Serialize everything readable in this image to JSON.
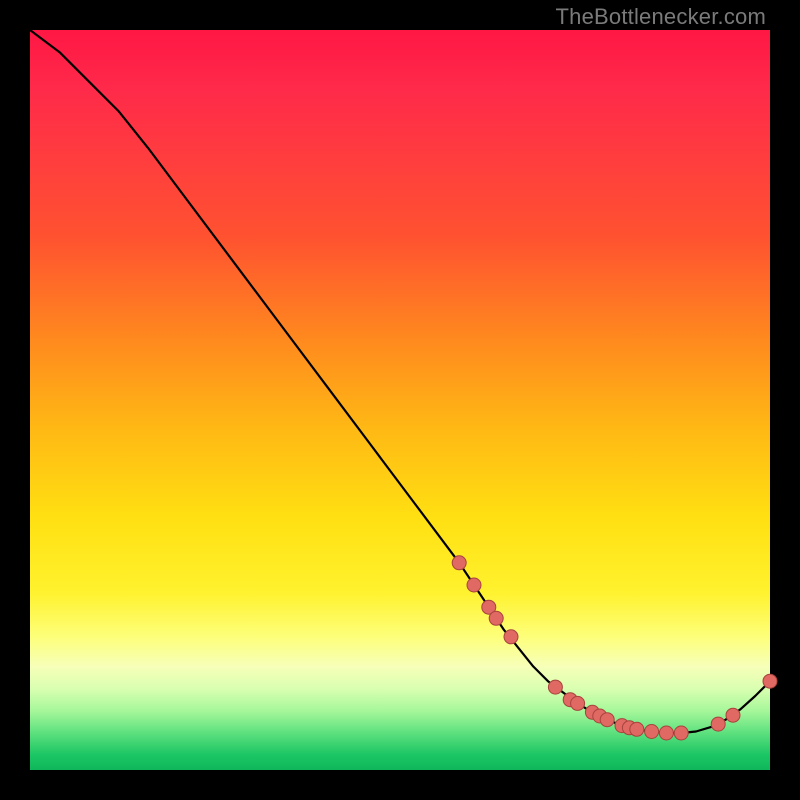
{
  "watermark": "TheBottlenecker.com",
  "colors": {
    "background": "#000000",
    "gradient_top": "#ff1744",
    "gradient_bottom": "#0fb75a",
    "line": "#000000",
    "point_fill": "#e06963",
    "point_stroke": "#a8433e"
  },
  "chart_data": {
    "type": "line",
    "title": "",
    "xlabel": "",
    "ylabel": "",
    "xlim": [
      0,
      100
    ],
    "ylim": [
      0,
      100
    ],
    "series": [
      {
        "name": "bottleneck-curve",
        "x": [
          0,
          4,
          8,
          12,
          16,
          22,
          28,
          34,
          40,
          46,
          52,
          58,
          60,
          62,
          64,
          66,
          68,
          70,
          72,
          74,
          76,
          78,
          80,
          82,
          84,
          86,
          88,
          90,
          92,
          94,
          96,
          98,
          100
        ],
        "y": [
          100,
          97,
          93,
          89,
          84,
          76,
          68,
          60,
          52,
          44,
          36,
          28,
          25,
          22,
          19,
          16.5,
          14,
          12,
          10.5,
          9,
          7.8,
          6.8,
          6,
          5.5,
          5.2,
          5,
          5,
          5.2,
          5.8,
          6.8,
          8.2,
          10,
          12
        ]
      }
    ],
    "markers": {
      "name": "highlighted-points",
      "x": [
        58,
        60,
        62,
        63,
        65,
        71,
        73,
        74,
        76,
        77,
        78,
        80,
        81,
        82,
        84,
        86,
        88,
        93,
        95,
        100
      ],
      "y": [
        28,
        25,
        22,
        20.5,
        18,
        11.2,
        9.5,
        9,
        7.8,
        7.3,
        6.8,
        6,
        5.7,
        5.5,
        5.2,
        5,
        5,
        6.2,
        7.4,
        12
      ]
    }
  }
}
